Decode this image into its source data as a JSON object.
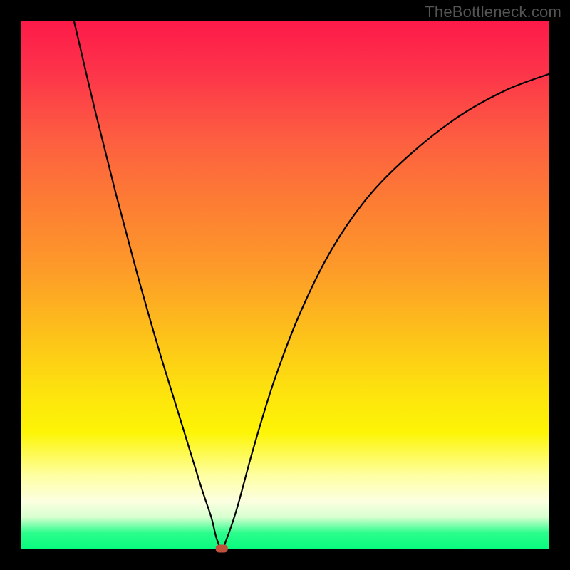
{
  "watermark": "TheBottleneck.com",
  "colors": {
    "frame_bg": "#000000",
    "gradient_top": "#fd1a49",
    "gradient_bottom": "#09fb7e",
    "curve": "#000000",
    "marker": "#c0523c"
  },
  "chart_data": {
    "type": "line",
    "title": "",
    "xlabel": "",
    "ylabel": "",
    "xlim": [
      0,
      100
    ],
    "ylim": [
      0,
      100
    ],
    "legend": false,
    "grid": false,
    "min_point": {
      "x": 38,
      "y": 0
    },
    "series": [
      {
        "name": "curve",
        "x": [
          10,
          14,
          18,
          22,
          26,
          30,
          34,
          36,
          37,
          38,
          39,
          41,
          44,
          48,
          53,
          59,
          66,
          74,
          83,
          92,
          100
        ],
        "y": [
          100,
          83,
          67,
          52,
          38,
          25,
          12,
          6,
          2,
          0,
          2,
          8,
          19,
          32,
          45,
          57,
          67,
          75,
          82,
          87,
          90
        ]
      }
    ],
    "annotations": [
      {
        "type": "marker",
        "x": 38,
        "y": 0,
        "shape": "rounded-rect"
      }
    ]
  }
}
